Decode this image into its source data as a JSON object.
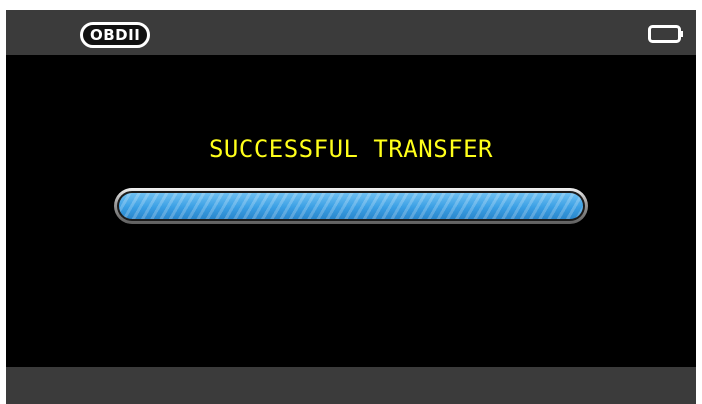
{
  "status_bar": {
    "mode_badge": "OBDII",
    "battery_icon": "battery-icon"
  },
  "main": {
    "message": "SUCCESSFUL TRANSFER",
    "progress": 1.0
  },
  "colors": {
    "message_text": "#ffff1a",
    "progress_fill": "#3a9fe4",
    "bar_background": "#3b3b3b",
    "screen_background": "#000000"
  }
}
